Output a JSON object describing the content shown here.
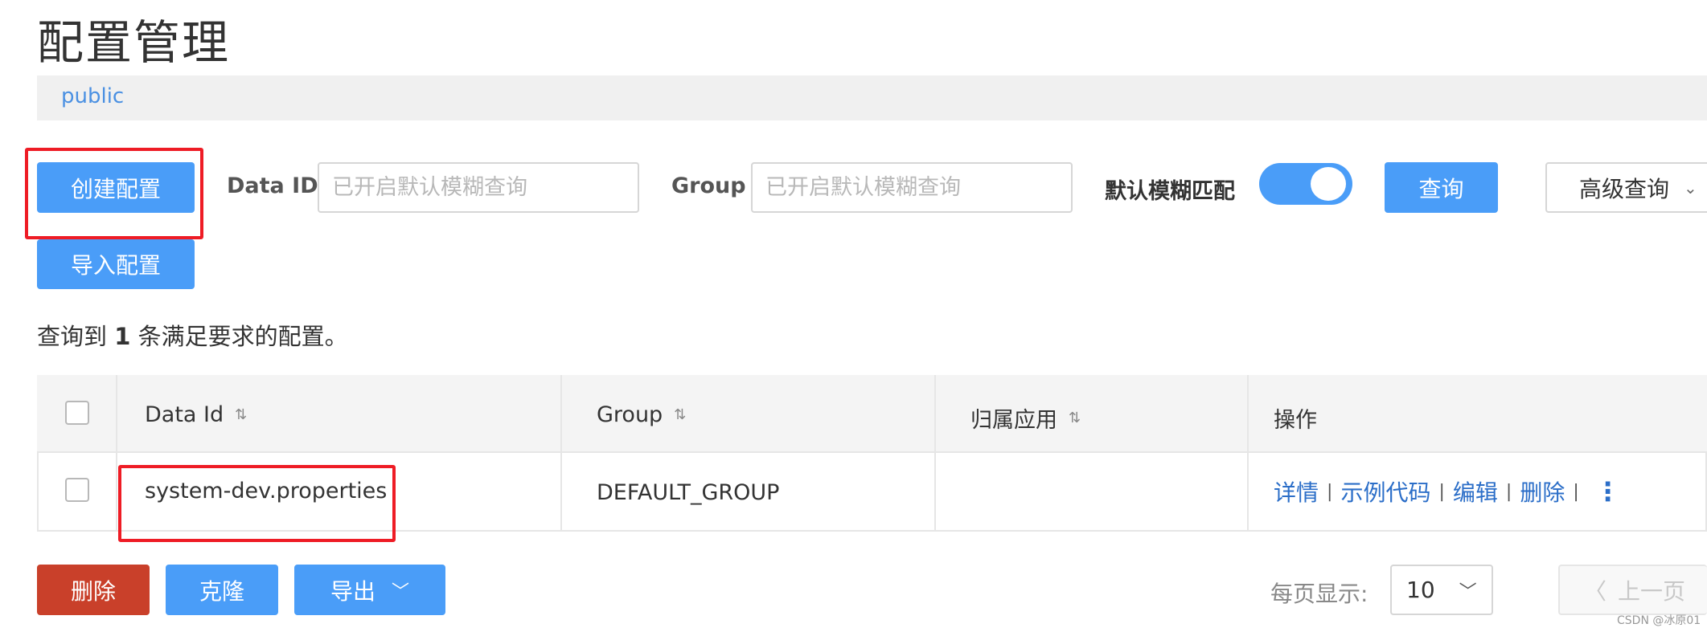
{
  "page": {
    "title": "配置管理"
  },
  "namespace": {
    "current": "public"
  },
  "toolbar": {
    "create_label": "创建配置",
    "import_label": "导入配置",
    "data_id_label": "Data ID",
    "data_id_placeholder": "已开启默认模糊查询",
    "group_label": "Group",
    "group_placeholder": "已开启默认模糊查询",
    "fuzzy_label": "默认模糊匹配",
    "fuzzy_enabled": true,
    "query_label": "查询",
    "advanced_label": "高级查询"
  },
  "result": {
    "prefix": "查询到",
    "count": "1",
    "suffix": "条满足要求的配置。"
  },
  "table": {
    "columns": [
      "Data Id",
      "Group",
      "归属应用",
      "操作"
    ],
    "rows": [
      {
        "data_id": "system-dev.properties",
        "group": "DEFAULT_GROUP",
        "app": ""
      }
    ],
    "actions": [
      "详情",
      "示例代码",
      "编辑",
      "删除"
    ],
    "separator": "|"
  },
  "bottom": {
    "delete_label": "删除",
    "clone_label": "克隆",
    "export_label": "导出",
    "per_page_label": "每页显示:",
    "page_size": "10",
    "prev_label": "上一页"
  },
  "watermark": "CSDN @冰原01",
  "colors": {
    "primary": "#4a9df8",
    "danger": "#c9402a",
    "link": "#2b6ec8",
    "highlight_frame": "#ee1c25"
  }
}
